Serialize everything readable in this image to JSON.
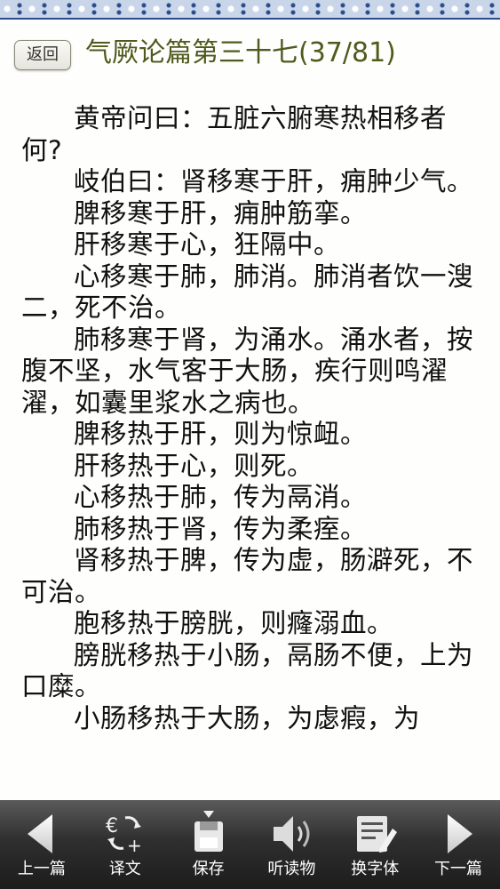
{
  "header": {
    "back_label": "返回",
    "title": "气厥论篇第三十七(37/81)"
  },
  "content": {
    "paragraphs": [
      "黄帝问曰：五脏六腑寒热相移者何?",
      "岐伯曰：肾移寒于肝，痈肿少气。",
      "脾移寒于肝，痈肿筋挛。",
      "肝移寒于心，狂隔中。",
      "心移寒于肺，肺消。肺消者饮一溲二，死不治。",
      "肺移寒于肾，为涌水。涌水者，按腹不坚，水气客于大肠，疾行则鸣濯濯，如囊里浆水之病也。",
      "脾移热于肝，则为惊衄。",
      "肝移热于心，则死。",
      "心移热于肺，传为鬲消。",
      "肺移热于肾，传为柔痓。",
      "肾移热于脾，传为虚，肠澼死，不可治。",
      "胞移热于膀胱，则癃溺血。",
      "膀胱移热于小肠，鬲肠不便，上为口糜。",
      "小肠移热于大肠，为虙瘕，为"
    ]
  },
  "toolbar": {
    "prev_label": "上一篇",
    "translate_label": "译文",
    "save_label": "保存",
    "listen_label": "听读物",
    "font_label": "换字体",
    "next_label": "下一篇"
  }
}
